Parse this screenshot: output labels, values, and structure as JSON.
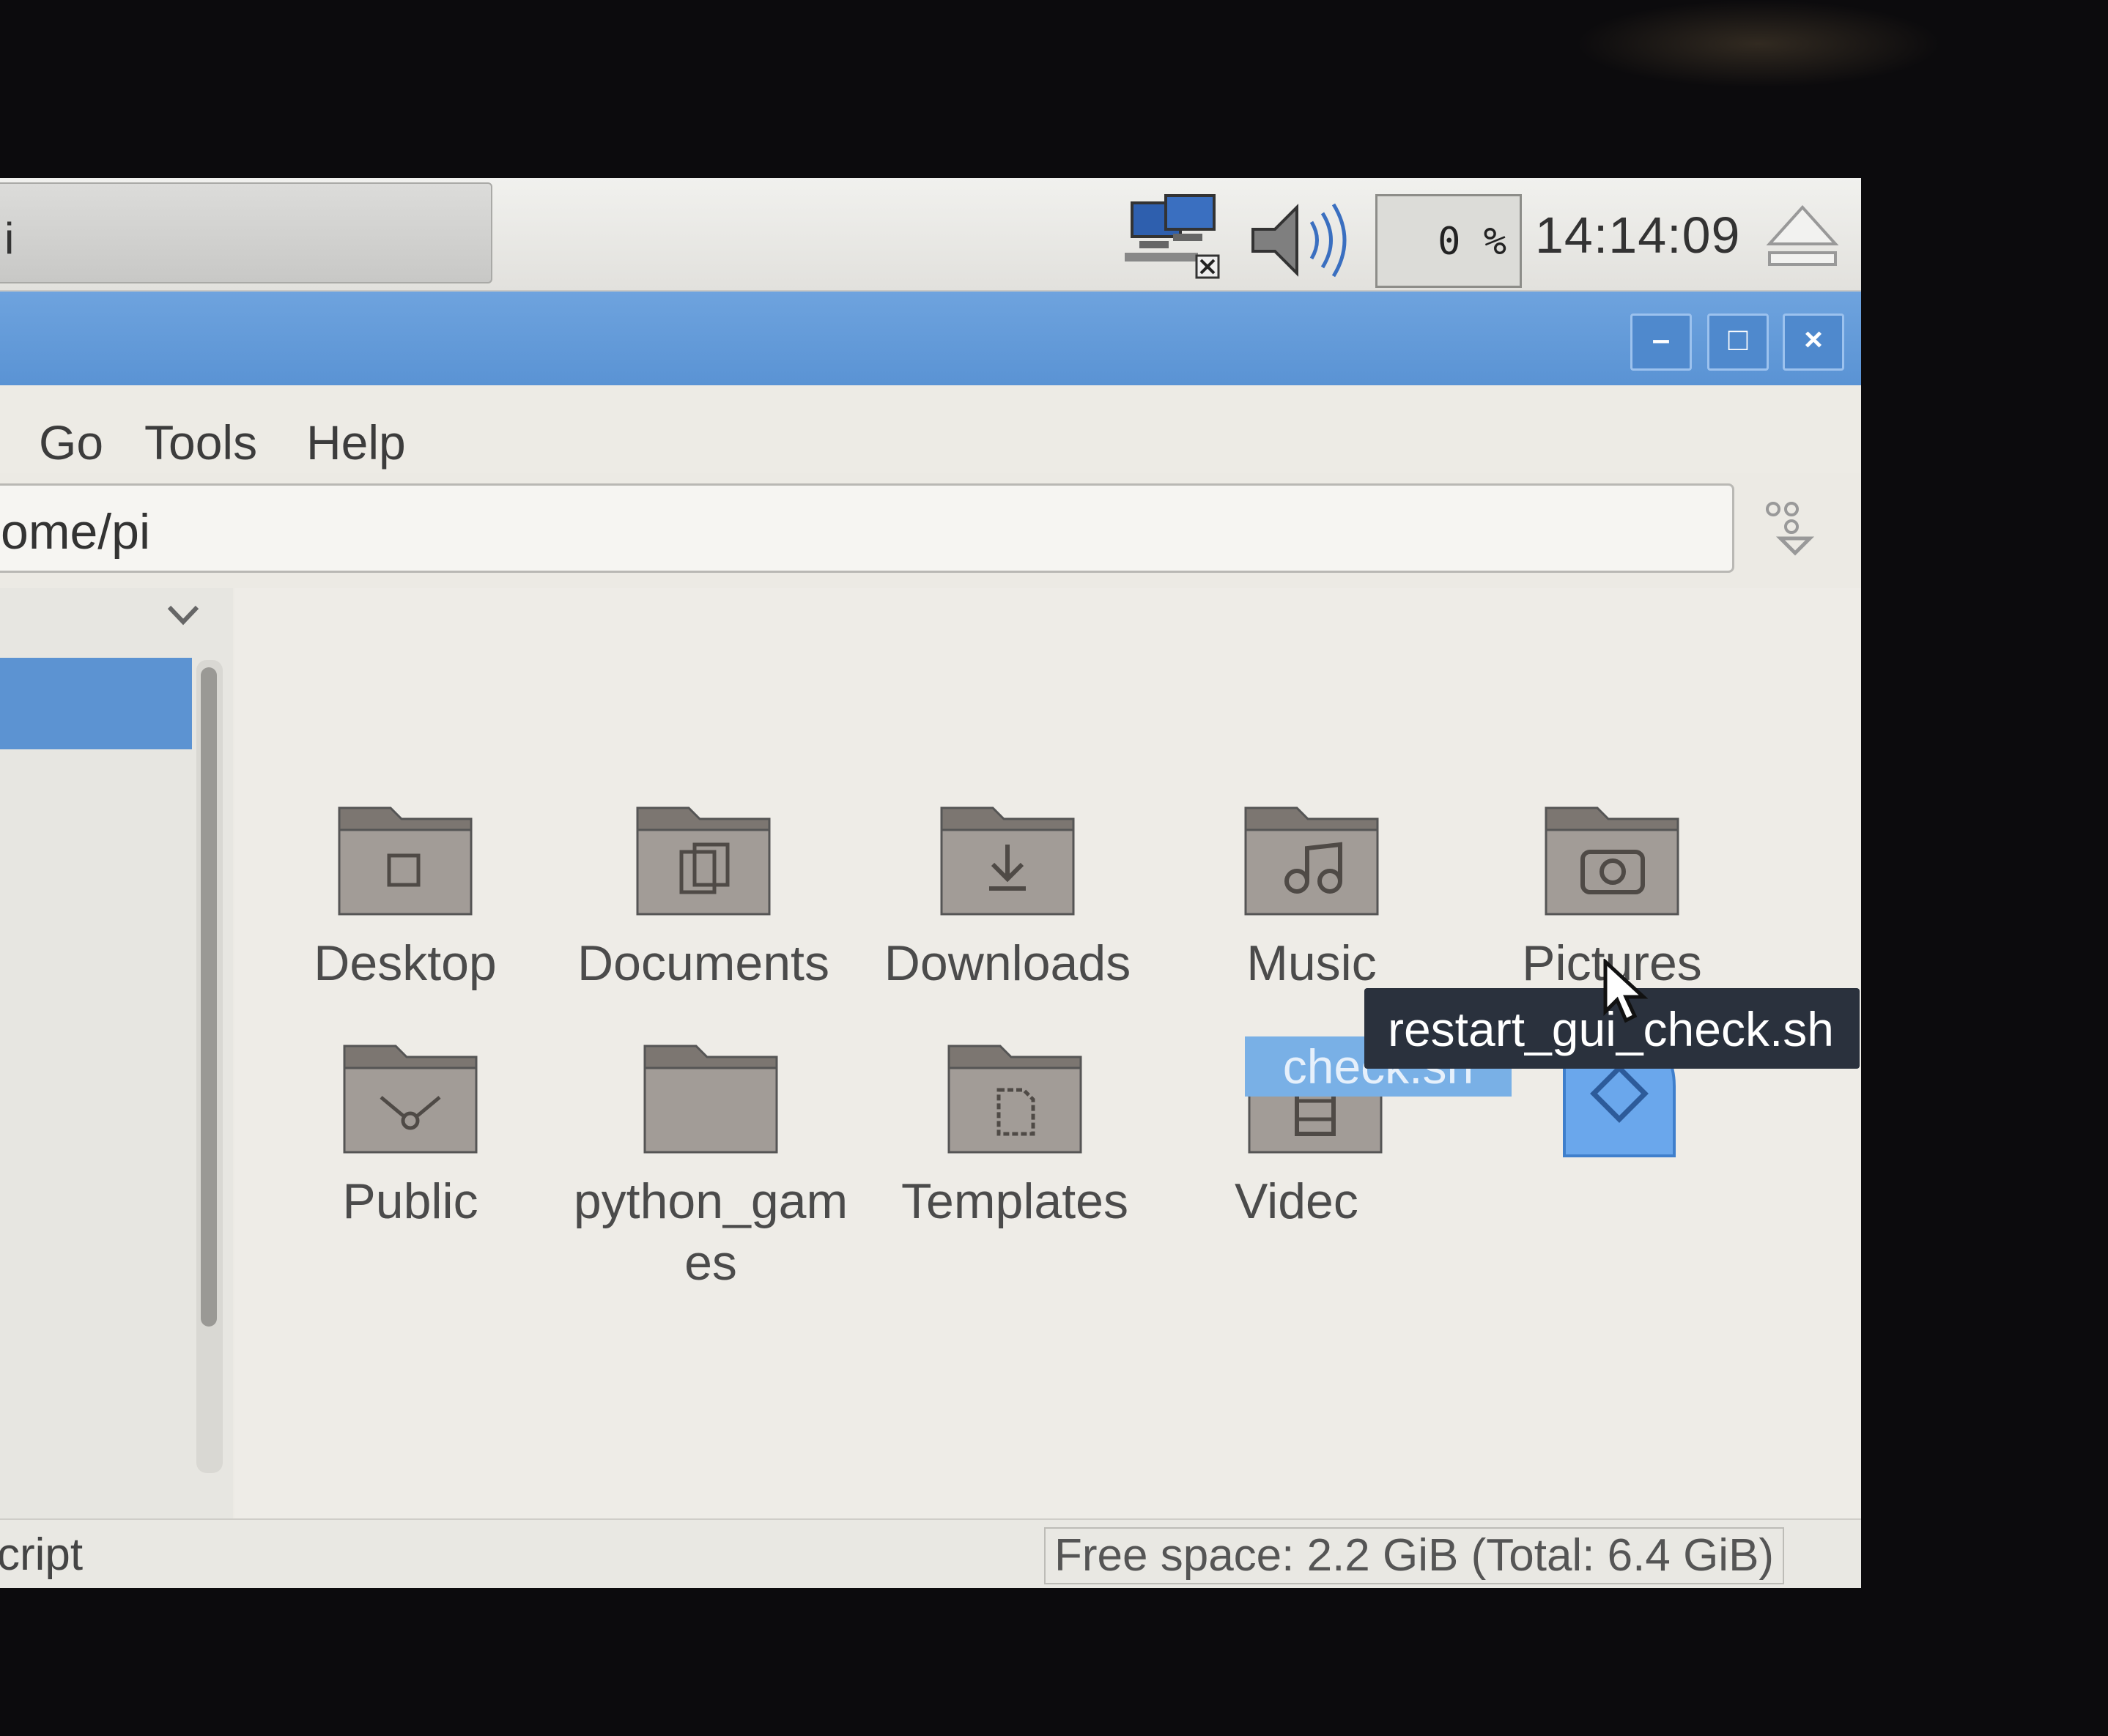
{
  "taskbar": {
    "task_button_label": "i",
    "cpu_usage": "0 %",
    "clock": "14:14:09"
  },
  "window": {
    "title_buttons": {
      "minimize": "–",
      "maximize": "□",
      "close": "×"
    }
  },
  "menubar": {
    "items": [
      "Go",
      "Tools",
      "Help"
    ]
  },
  "location": {
    "path": "ome/pi"
  },
  "files": [
    {
      "name": "Desktop",
      "icon": "folder-desktop-icon"
    },
    {
      "name": "Documents",
      "icon": "folder-documents-icon"
    },
    {
      "name": "Downloads",
      "icon": "folder-downloads-icon"
    },
    {
      "name": "Music",
      "icon": "folder-music-icon"
    },
    {
      "name": "Pictures",
      "icon": "folder-pictures-icon"
    },
    {
      "name": "Public",
      "icon": "folder-public-icon"
    },
    {
      "name": "python_gam\nes",
      "icon": "folder-icon"
    },
    {
      "name": "Templates",
      "icon": "folder-templates-icon"
    },
    {
      "name": "Videc",
      "icon": "folder-videos-icon"
    },
    {
      "name": "restart_gui_check.sh",
      "icon": "script-link-icon",
      "selected": true,
      "visible_label": "check.sh"
    }
  ],
  "tooltip": {
    "text": "restart_gui_check.sh"
  },
  "statusbar": {
    "left": "cript",
    "free_space": "Free space: 2.2 GiB (Total: 6.4 GiB)"
  },
  "colors": {
    "titlebar": "#6ea3de",
    "selection": "#79b0e6",
    "folder": "#8f8a85",
    "tooltip_bg": "#2a313d"
  }
}
